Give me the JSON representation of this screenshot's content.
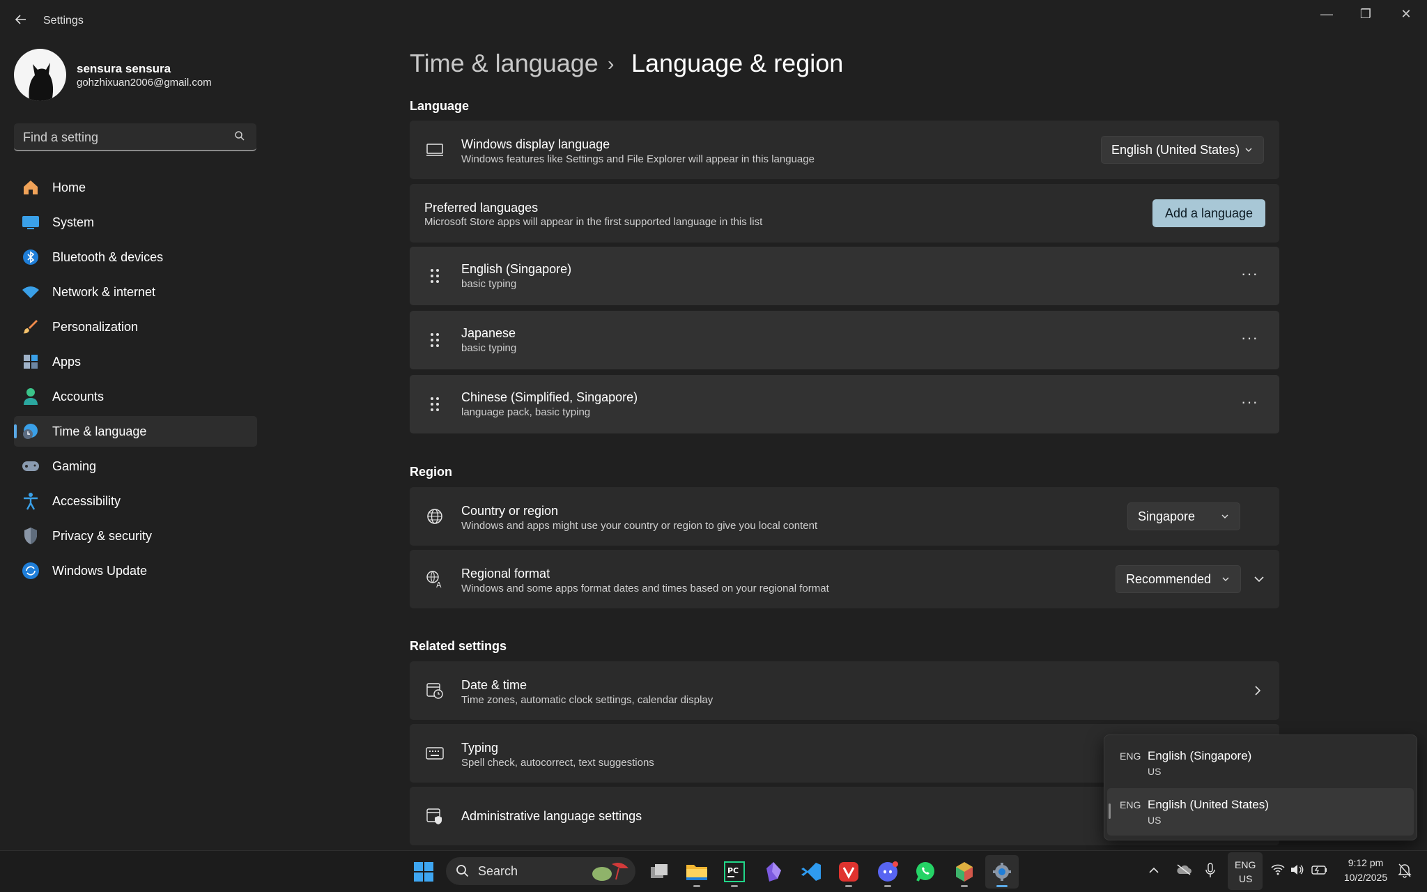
{
  "window": {
    "title": "Settings",
    "minimize": "—",
    "restore": "❐",
    "close": "✕"
  },
  "user": {
    "name": "sensura sensura",
    "email": "gohzhixuan2006@gmail.com"
  },
  "search": {
    "placeholder": "Find a setting"
  },
  "sidebar": {
    "items": [
      {
        "label": "Home",
        "icon": "home-icon"
      },
      {
        "label": "System",
        "icon": "system-icon"
      },
      {
        "label": "Bluetooth & devices",
        "icon": "bluetooth-icon"
      },
      {
        "label": "Network & internet",
        "icon": "wifi-icon"
      },
      {
        "label": "Personalization",
        "icon": "brush-icon"
      },
      {
        "label": "Apps",
        "icon": "apps-icon"
      },
      {
        "label": "Accounts",
        "icon": "accounts-icon"
      },
      {
        "label": "Time & language",
        "icon": "time-language-icon",
        "selected": true
      },
      {
        "label": "Gaming",
        "icon": "gamepad-icon"
      },
      {
        "label": "Accessibility",
        "icon": "accessibility-icon"
      },
      {
        "label": "Privacy & security",
        "icon": "shield-icon"
      },
      {
        "label": "Windows Update",
        "icon": "update-icon"
      }
    ]
  },
  "breadcrumb": {
    "parent": "Time & language",
    "separator": "›",
    "current": "Language & region"
  },
  "language": {
    "heading": "Language",
    "display": {
      "title": "Windows display language",
      "subtitle": "Windows features like Settings and File Explorer will appear in this language",
      "value": "English (United States)"
    },
    "preferred": {
      "title": "Preferred languages",
      "subtitle": "Microsoft Store apps will appear in the first supported language in this list",
      "button": "Add a language"
    },
    "items": [
      {
        "name": "English (Singapore)",
        "detail": "basic typing"
      },
      {
        "name": "Japanese",
        "detail": "basic typing"
      },
      {
        "name": "Chinese (Simplified, Singapore)",
        "detail": "language pack, basic typing"
      }
    ],
    "more": "···"
  },
  "region": {
    "heading": "Region",
    "country": {
      "title": "Country or region",
      "subtitle": "Windows and apps might use your country or region to give you local content",
      "value": "Singapore"
    },
    "format": {
      "title": "Regional format",
      "subtitle": "Windows and some apps format dates and times based on your regional format",
      "value": "Recommended"
    }
  },
  "related": {
    "heading": "Related settings",
    "datetime": {
      "title": "Date & time",
      "subtitle": "Time zones, automatic clock settings, calendar display"
    },
    "typing": {
      "title": "Typing",
      "subtitle": "Spell check, autocorrect, text suggestions"
    },
    "admin": {
      "title": "Administrative language settings"
    }
  },
  "flyout": {
    "items": [
      {
        "code": "ENG",
        "name": "English (Singapore)",
        "sub": "US"
      },
      {
        "code": "ENG",
        "name": "English (United States)",
        "sub": "US",
        "active": true
      }
    ]
  },
  "taskbar": {
    "search_label": "Search",
    "ime_top": "ENG",
    "ime_bottom": "US",
    "time": "9:12 pm",
    "date": "10/2/2025"
  },
  "colors": {
    "background": "#202020",
    "card": "#2b2b2b",
    "accent": "#5aa9e6",
    "taskbar": "#1c1c1c"
  }
}
